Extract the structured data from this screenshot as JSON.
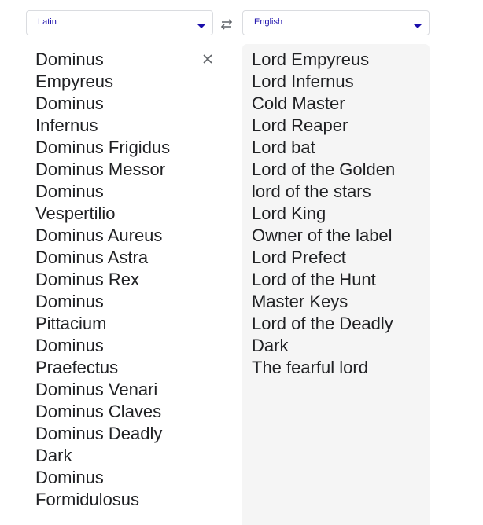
{
  "source": {
    "language": "Latin",
    "lines": [
      "Dominus",
      "Empyreus",
      "Dominus",
      "Infernus",
      "Dominus Frigidus",
      "Dominus Messor",
      "Dominus",
      "Vespertilio",
      "Dominus Aureus",
      "Dominus Astra",
      "Dominus Rex",
      "Dominus",
      "Pittacium",
      "Dominus",
      "Praefectus",
      "Dominus Venari",
      "Dominus Claves",
      "Dominus Deadly",
      "Dark",
      "Dominus",
      "Formidulosus"
    ]
  },
  "target": {
    "language": "English",
    "lines": [
      "Lord Empyreus",
      "Lord Infernus",
      "Cold Master",
      "Lord Reaper",
      "Lord bat",
      "Lord of the Golden",
      "lord of the stars",
      "Lord King",
      "Owner of the label",
      "Lord Prefect",
      "Lord of the Hunt",
      "Master Keys",
      "Lord of the Deadly",
      "Dark",
      "The fearful lord"
    ]
  },
  "icons": {
    "swap": "swap-arrows-icon",
    "clear": "close-icon",
    "dropdown": "caret-down-icon"
  },
  "colors": {
    "accent": "#1a0dab",
    "text": "#202124",
    "target_bg": "#f5f5f5"
  }
}
